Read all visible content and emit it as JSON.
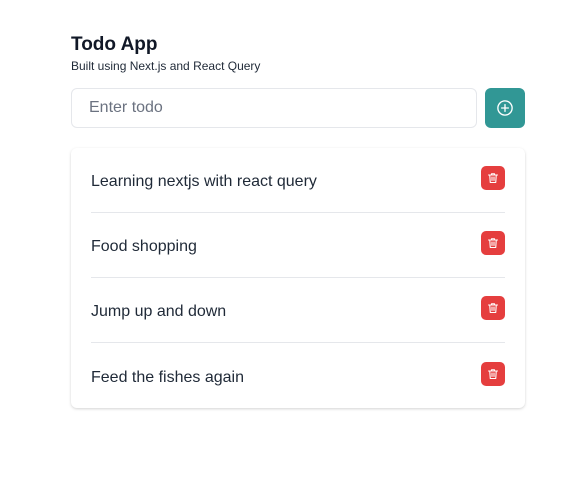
{
  "header": {
    "title": "Todo App",
    "subtitle": "Built using Next.js and React Query"
  },
  "input": {
    "placeholder": "Enter todo",
    "value": ""
  },
  "add_button": {
    "icon": "plus-circle-icon",
    "color": "#319795"
  },
  "todos": [
    {
      "text": "Learning nextjs with react query",
      "delete_icon": "trash-icon"
    },
    {
      "text": "Food shopping",
      "delete_icon": "trash-icon"
    },
    {
      "text": "Jump up and down",
      "delete_icon": "trash-icon"
    },
    {
      "text": "Feed the fishes again",
      "delete_icon": "trash-icon"
    }
  ],
  "colors": {
    "accent": "#319795",
    "danger": "#e53e3e"
  }
}
